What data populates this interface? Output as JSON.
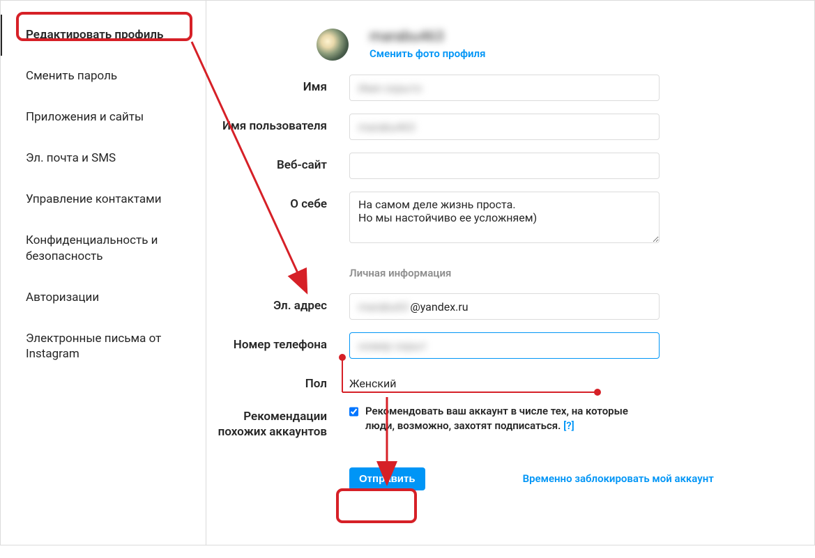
{
  "sidebar": {
    "items": [
      {
        "label": "Редактировать профиль"
      },
      {
        "label": "Сменить пароль"
      },
      {
        "label": "Приложения и сайты"
      },
      {
        "label": "Эл. почта и SMS"
      },
      {
        "label": "Управление контактами"
      },
      {
        "label": "Конфиденциальность и безопасность"
      },
      {
        "label": "Авторизации"
      },
      {
        "label": "Электронные письма от Instagram"
      }
    ]
  },
  "profile": {
    "username_blurred": "marabu463",
    "change_photo_label": "Сменить фото профиля"
  },
  "form": {
    "name_label": "Имя",
    "name_value_blurred": "Имя скрыто",
    "username_label": "Имя пользователя",
    "username_value_blurred": "marabu463",
    "website_label": "Веб-сайт",
    "website_value": "",
    "bio_label": "О себе",
    "bio_value": "На самом деле жизнь проста.\nНо мы настойчиво ее усложняем)",
    "private_info_header": "Личная информация",
    "email_label": "Эл. адрес",
    "email_blurred_part": "marabu63",
    "email_visible_part": "@yandex.ru",
    "phone_label": "Номер телефона",
    "phone_value_blurred": "номер скрыт",
    "gender_label": "Пол",
    "gender_value": "Женский",
    "recommend_label": "Рекомендации похожих аккаунтов",
    "recommend_text": "Рекомендовать ваш аккаунт в числе тех, на которые люди, возможно, захотят подписаться.",
    "recommend_help": "[?]",
    "recommend_checked": true,
    "submit_label": "Отправить",
    "disable_account_label": "Временно заблокировать мой аккаунт"
  }
}
